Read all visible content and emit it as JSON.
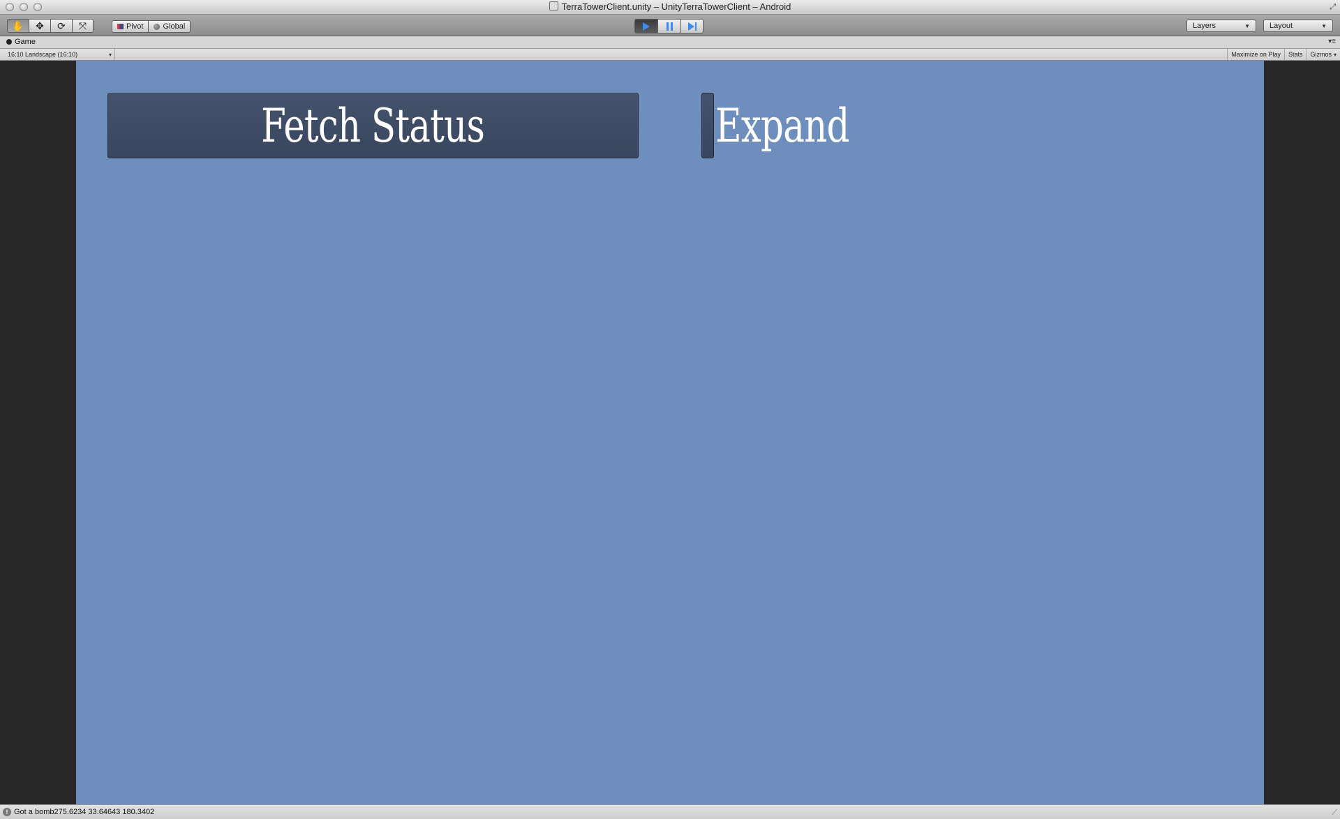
{
  "window": {
    "title": "TerraTowerClient.unity – UnityTerraTowerClient – Android"
  },
  "toolbar": {
    "tools": [
      {
        "name": "hand-tool",
        "icon": "✋"
      },
      {
        "name": "move-tool",
        "icon": "✥"
      },
      {
        "name": "rotate-tool",
        "icon": "⟳"
      },
      {
        "name": "scale-tool",
        "icon": "⤧"
      }
    ],
    "pivot_label": "Pivot",
    "global_label": "Global",
    "layers_label": "Layers",
    "layout_label": "Layout"
  },
  "game_tab": {
    "label": "Game"
  },
  "game_bar": {
    "aspect": "16:10 Landscape (16:10)",
    "maximize_label": "Maximize on Play",
    "stats_label": "Stats",
    "gizmos_label": "Gizmos"
  },
  "game": {
    "fetch_button_label": "Fetch Status",
    "expand_label": "Expand",
    "background_color": "#6e8ebd",
    "button_color": "#3f4c65"
  },
  "status": {
    "message": "Got a bomb275.6234 33.64643 180.3402"
  }
}
